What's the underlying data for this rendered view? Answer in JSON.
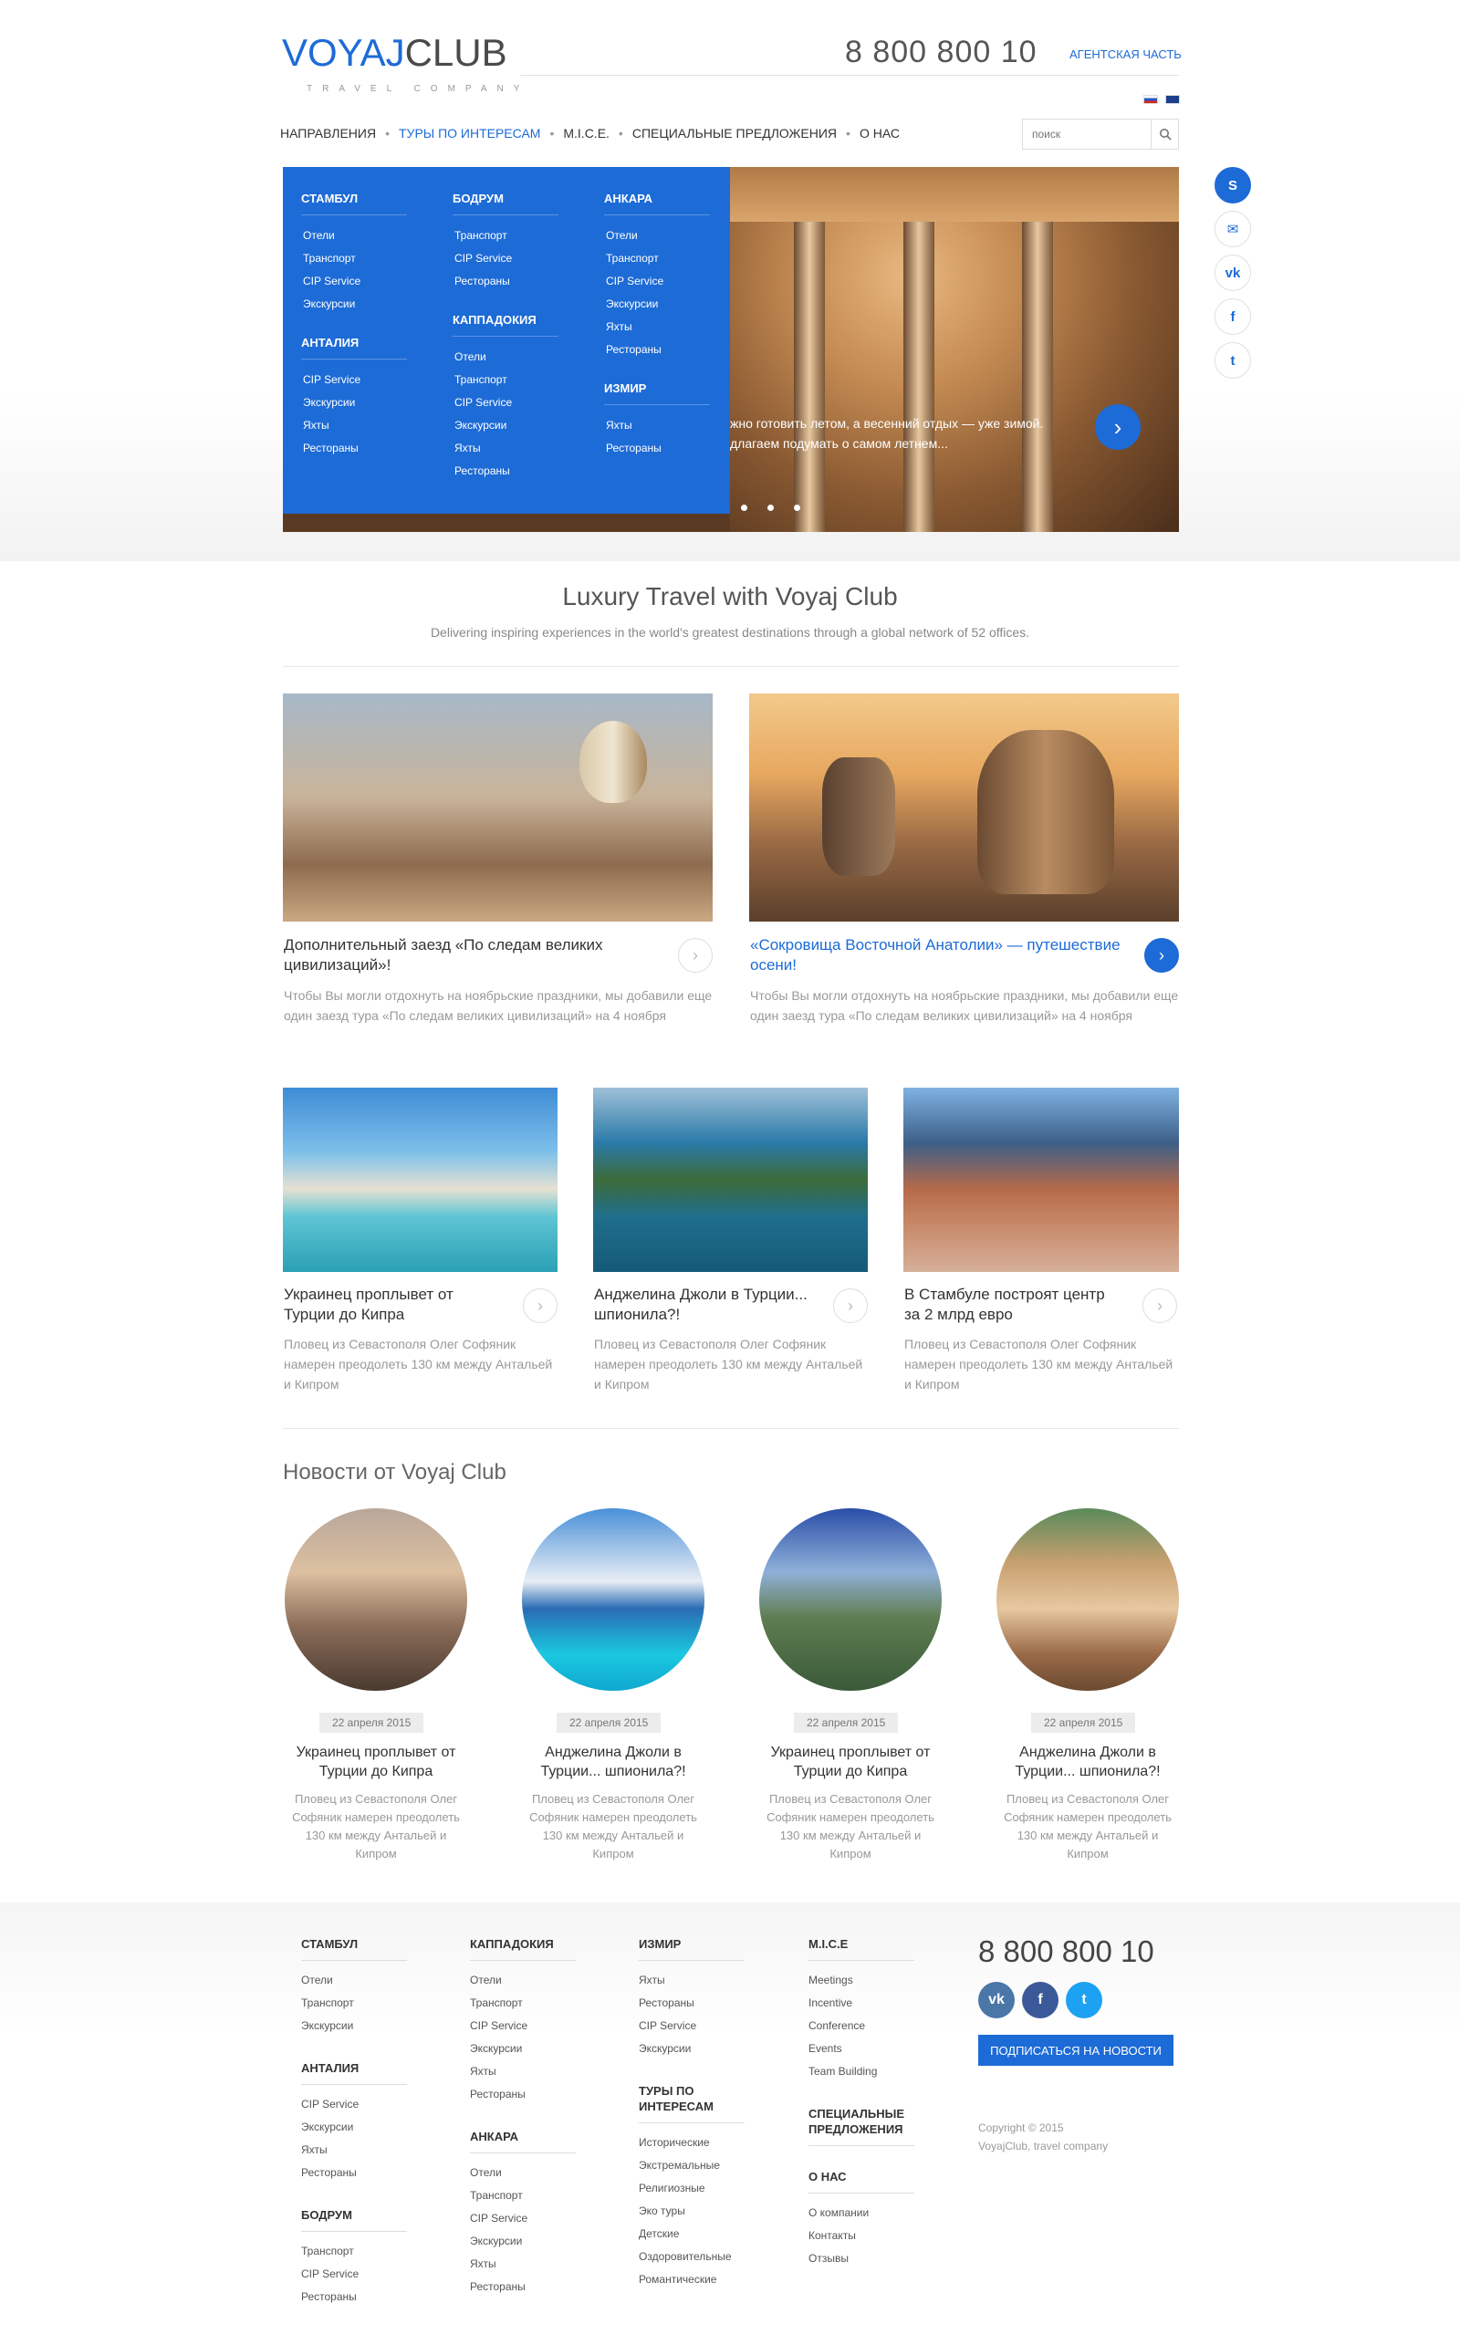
{
  "header": {
    "logo_bold": "VOYAJ",
    "logo_light": "CLUB",
    "tagline": "TRAVEL COMPANY",
    "phone": "8 800 800 10",
    "agency_link": "АГЕНТСКАЯ ЧАСТЬ",
    "search_placeholder": "поиск"
  },
  "nav": {
    "items": [
      {
        "label": "НАПРАВЛЕНИЯ"
      },
      {
        "label": "ТУРЫ ПО ИНТЕРЕСАМ"
      },
      {
        "label": "M.I.C.E."
      },
      {
        "label": "СПЕЦИАЛЬНЫЕ ПРЕДЛОЖЕНИЯ"
      },
      {
        "label": "О НАС"
      }
    ]
  },
  "megamenu": {
    "col1": [
      {
        "title": "СТАМБУЛ",
        "links": [
          "Отели",
          "Транспорт",
          "CIP Service",
          "Экскурсии"
        ]
      },
      {
        "title": "АНТАЛИЯ",
        "links": [
          "CIP Service",
          "Экскурсии",
          "Яхты",
          "Рестораны"
        ]
      }
    ],
    "col2": [
      {
        "title": "БОДРУМ",
        "links": [
          "Транспорт",
          "CIP Service",
          "Рестораны"
        ]
      },
      {
        "title": "КАППАДОКИЯ",
        "links": [
          "Отели",
          "Транспорт",
          "CIP Service",
          "Экскурсии",
          "Яхты",
          "Рестораны"
        ]
      }
    ],
    "col3": [
      {
        "title": "АНКАРА",
        "links": [
          "Отели",
          "Транспорт",
          "CIP Service",
          "Экскурсии",
          "Яхты",
          "Рестораны"
        ]
      },
      {
        "title": "ИЗМИР",
        "links": [
          "Яхты",
          "Рестораны"
        ]
      }
    ]
  },
  "hero": {
    "caption_line1": "жно готовить летом, а весенний отдых — уже зимой.",
    "caption_line2": "длагаем подумать о самом летнем..."
  },
  "intro": {
    "title": "Luxury Travel with Voyaj Club",
    "subtitle": "Delivering inspiring experiences in the world's greatest destinations through a global network of 52 offices."
  },
  "featured": [
    {
      "title": "Дополнительный заезд «По следам великих цивилизаций»!",
      "text": "Чтобы Вы могли отдохнуть на ноябрьские праздники, мы добавили еще один заезд тура «По следам великих цивилизаций» на 4 ноября"
    },
    {
      "title": "«Сокровища Восточной Анатолии» — путешествие осени!",
      "text": "Чтобы Вы могли отдохнуть на ноябрьские праздники, мы добавили еще один заезд тура «По следам великих цивилизаций» на 4 ноября"
    }
  ],
  "articles": [
    {
      "title": "Украинец проплывет от Турции до Кипра",
      "text": "Пловец из Севастополя Олег Софяник намерен преодолеть 130 км между Антальей и Кипром"
    },
    {
      "title": "Анджелина Джоли в Турции... шпионила?!",
      "text": "Пловец из Севастополя Олег Софяник намерен преодолеть 130 км между Антальей и Кипром"
    },
    {
      "title": "В Стамбуле построят центр за 2 млрд евро",
      "text": "Пловец из Севастополя Олег Софяник намерен преодолеть 130 км между Антальей и Кипром"
    }
  ],
  "news": {
    "heading": "Новости от Voyaj Club",
    "items": [
      {
        "date": "22 апреля 2015",
        "title": "Украинец проплывет от Турции до Кипра",
        "text": "Пловец из Севастополя Олег Софяник намерен преодолеть 130 км между Антальей и Кипром"
      },
      {
        "date": "22 апреля 2015",
        "title": "Анджелина Джоли в Турции... шпионила?!",
        "text": "Пловец из Севастополя Олег Софяник намерен преодолеть 130 км между Антальей и Кипром"
      },
      {
        "date": "22 апреля 2015",
        "title": "Украинец проплывет от Турции до Кипра",
        "text": "Пловец из Севастополя Олег Софяник намерен преодолеть 130 км между Антальей и Кипром"
      },
      {
        "date": "22 апреля 2015",
        "title": "Анджелина Джоли в Турции... шпионила?!",
        "text": "Пловец из Севастополя Олег Софяник намерен преодолеть 130 км между Антальей и Кипром"
      }
    ]
  },
  "footer": {
    "col1": [
      {
        "title": "СТАМБУЛ",
        "links": [
          "Отели",
          "Транспорт",
          "Экскурсии"
        ]
      },
      {
        "title": "АНТАЛИЯ",
        "links": [
          "CIP Service",
          "Экскурсии",
          "Яхты",
          "Рестораны"
        ]
      },
      {
        "title": "БОДРУМ",
        "links": [
          "Транспорт",
          "CIP Service",
          "Рестораны"
        ]
      }
    ],
    "col2": [
      {
        "title": "КАППАДОКИЯ",
        "links": [
          "Отели",
          "Транспорт",
          "CIP Service",
          "Экскурсии",
          "Яхты",
          "Рестораны"
        ]
      },
      {
        "title": "АНКАРА",
        "links": [
          "Отели",
          "Транспорт",
          "CIP Service",
          "Экскурсии",
          "Яхты",
          "Рестораны"
        ]
      }
    ],
    "col3": [
      {
        "title": "ИЗМИР",
        "links": [
          "Яхты",
          "Рестораны",
          "CIP Service",
          "Экскурсии"
        ]
      },
      {
        "title": "ТУРЫ ПО ИНТЕРЕСАМ",
        "links": [
          "Исторические",
          "Экстремальные",
          "Религиозные",
          "Эко туры",
          "Детские",
          "Оздоровительные",
          "Романтические"
        ]
      }
    ],
    "col4": [
      {
        "title": "M.I.C.E",
        "links": [
          "Meetings",
          "Incentive",
          "Conference",
          "Events",
          "Team Building"
        ]
      },
      {
        "title": "СПЕЦИАЛЬНЫЕ ПРЕДЛОЖЕНИЯ",
        "links": []
      },
      {
        "title": "О НАС",
        "links": [
          "О компании",
          "Контакты",
          "Отзывы"
        ]
      }
    ],
    "phone": "8 800 800 10",
    "subscribe": "ПОДПИСАТЬСЯ НА НОВОСТИ",
    "copyright": "Copyright © 2015 VoyajClub, travel company"
  },
  "colors": {
    "accent": "#1d6bd6",
    "vk": "#4a76a8",
    "facebook": "#3b5998",
    "twitter": "#1da1f2"
  }
}
